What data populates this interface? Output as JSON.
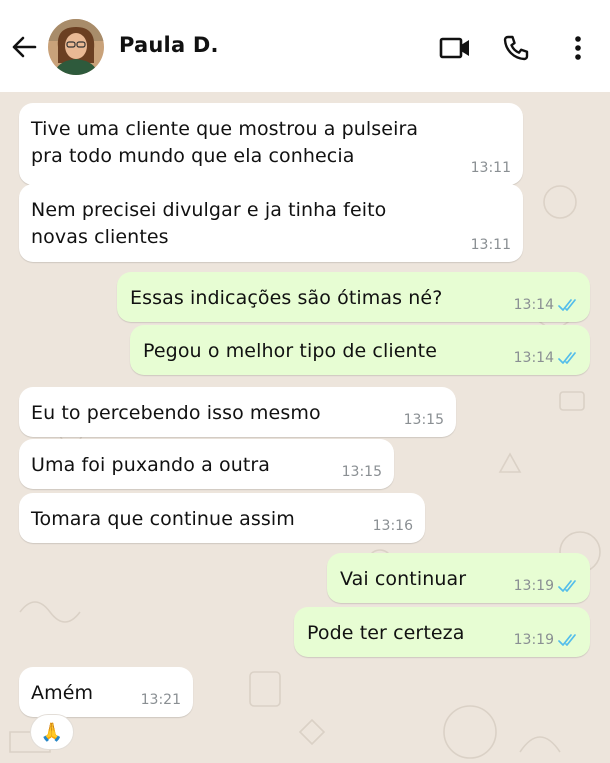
{
  "header": {
    "contact_name": "Paula D."
  },
  "icons": {
    "back": "arrow-left-icon",
    "video": "video-camera-icon",
    "call": "phone-icon",
    "menu": "more-vertical-icon"
  },
  "colors": {
    "incoming_bubble": "#ffffff",
    "outgoing_bubble": "#e7fdd3",
    "read_ticks": "#53bdeb",
    "chat_background": "#ede5dc"
  },
  "messages": [
    {
      "direction": "in",
      "text": "Tive uma cliente que mostrou a pulseira\npra todo mundo que ela conhecia",
      "time": "13:11"
    },
    {
      "direction": "in",
      "text": "Nem precisei divulgar e ja tinha feito\nnovas clientes",
      "time": "13:11"
    },
    {
      "direction": "out",
      "text": "Essas indicações são ótimas né?",
      "time": "13:14",
      "status": "read"
    },
    {
      "direction": "out",
      "text": "Pegou o melhor tipo de cliente",
      "time": "13:14",
      "status": "read"
    },
    {
      "direction": "in",
      "text": "Eu to percebendo isso mesmo",
      "time": "13:15"
    },
    {
      "direction": "in",
      "text": "Uma foi puxando a outra",
      "time": "13:15"
    },
    {
      "direction": "in",
      "text": "Tomara que continue assim",
      "time": "13:16"
    },
    {
      "direction": "out",
      "text": "Vai continuar",
      "time": "13:19",
      "status": "read"
    },
    {
      "direction": "out",
      "text": "Pode ter certeza",
      "time": "13:19",
      "status": "read"
    },
    {
      "direction": "in",
      "text": "Amém",
      "time": "13:21",
      "reaction": "🙏"
    }
  ]
}
